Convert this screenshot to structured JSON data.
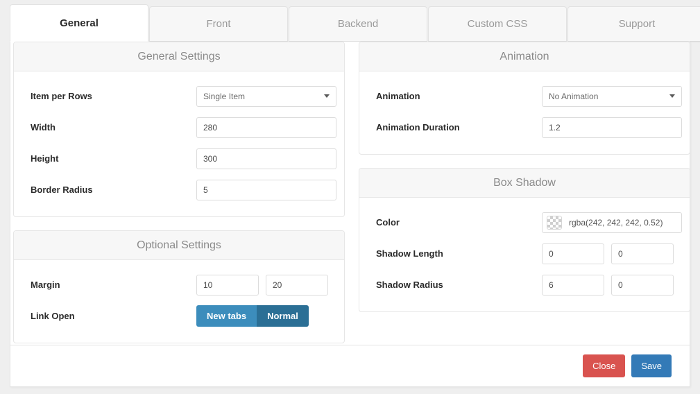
{
  "tabs": [
    {
      "label": "General",
      "active": true
    },
    {
      "label": "Front",
      "active": false
    },
    {
      "label": "Backend",
      "active": false
    },
    {
      "label": "Custom CSS",
      "active": false
    },
    {
      "label": "Support",
      "active": false
    }
  ],
  "panels": {
    "general_settings": {
      "title": "General Settings",
      "fields": {
        "item_per_rows": {
          "label": "Item per Rows",
          "value": "Single Item"
        },
        "width": {
          "label": "Width",
          "value": "280"
        },
        "height": {
          "label": "Height",
          "value": "300"
        },
        "border_radius": {
          "label": "Border Radius",
          "value": "5"
        }
      }
    },
    "optional_settings": {
      "title": "Optional Settings",
      "fields": {
        "margin": {
          "label": "Margin",
          "value1": "10",
          "value2": "20"
        },
        "link_open": {
          "label": "Link Open",
          "option1": "New tabs",
          "option2": "Normal",
          "selected": "Normal"
        }
      }
    },
    "animation": {
      "title": "Animation",
      "fields": {
        "animation": {
          "label": "Animation",
          "value": "No Animation"
        },
        "animation_duration": {
          "label": "Animation Duration",
          "value": "1.2"
        }
      }
    },
    "box_shadow": {
      "title": "Box Shadow",
      "fields": {
        "color": {
          "label": "Color",
          "value": "rgba(242, 242, 242, 0.52)"
        },
        "shadow_length": {
          "label": "Shadow Length",
          "value1": "0",
          "value2": "0"
        },
        "shadow_radius": {
          "label": "Shadow Radius",
          "value1": "6",
          "value2": "0"
        }
      }
    }
  },
  "footer": {
    "close_label": "Close",
    "save_label": "Save"
  },
  "colors": {
    "primary": "#3c8dbc",
    "primary_active": "#2b6f95",
    "danger": "#d9534f",
    "save": "#337ab7"
  }
}
